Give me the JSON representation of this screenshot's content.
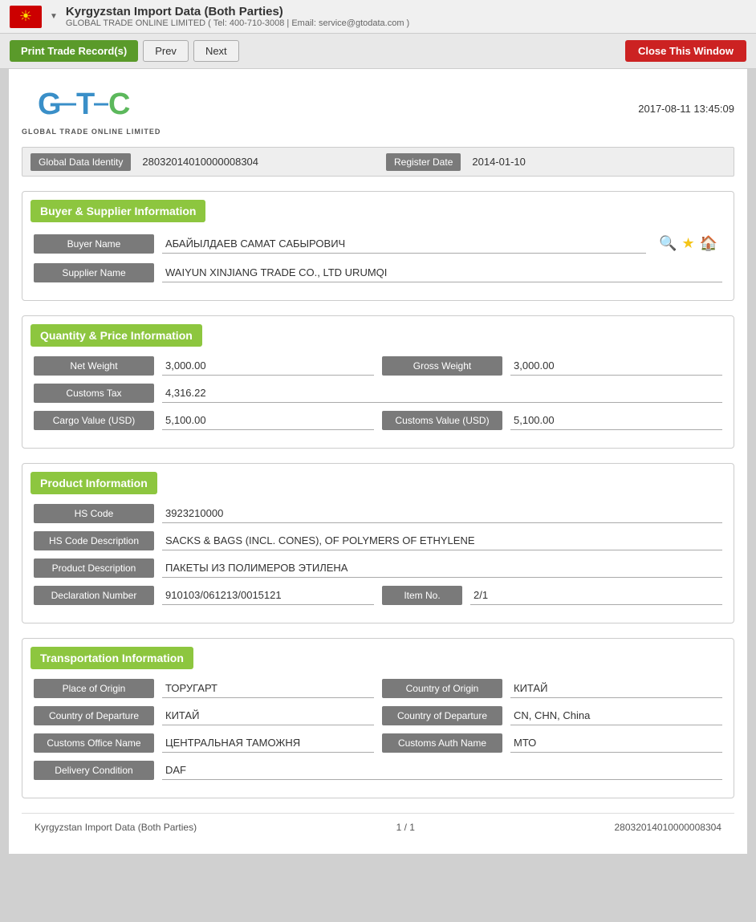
{
  "topbar": {
    "flag_emoji": "🏳",
    "title": "Kyrgyzstan Import Data (Both Parties)",
    "subtitle": "GLOBAL TRADE ONLINE LIMITED ( Tel: 400-710-3008 | Email: service@gtodata.com )",
    "dropdown_label": "▼"
  },
  "toolbar": {
    "print_label": "Print Trade Record(s)",
    "prev_label": "Prev",
    "next_label": "Next",
    "close_label": "Close This Window"
  },
  "record": {
    "timestamp": "2017-08-11 13:45:09",
    "global_data_identity_label": "Global Data Identity",
    "global_data_identity_value": "28032014010000008304",
    "register_date_label": "Register Date",
    "register_date_value": "2014-01-10",
    "sections": {
      "buyer_supplier": {
        "title": "Buyer & Supplier Information",
        "buyer_name_label": "Buyer Name",
        "buyer_name_value": "АБАЙЫЛДАЕВ САМАТ САБЫРОВИЧ",
        "supplier_name_label": "Supplier Name",
        "supplier_name_value": "WAIYUN XINJIANG TRADE CO., LTD URUMQI"
      },
      "quantity_price": {
        "title": "Quantity & Price Information",
        "net_weight_label": "Net Weight",
        "net_weight_value": "3,000.00",
        "gross_weight_label": "Gross Weight",
        "gross_weight_value": "3,000.00",
        "customs_tax_label": "Customs Tax",
        "customs_tax_value": "4,316.22",
        "cargo_value_label": "Cargo Value (USD)",
        "cargo_value_value": "5,100.00",
        "customs_value_label": "Customs Value (USD)",
        "customs_value_value": "5,100.00"
      },
      "product": {
        "title": "Product Information",
        "hs_code_label": "HS Code",
        "hs_code_value": "3923210000",
        "hs_code_desc_label": "HS Code Description",
        "hs_code_desc_value": "SACKS & BAGS (INCL. CONES), OF POLYMERS OF ETHYLENE",
        "product_desc_label": "Product Description",
        "product_desc_value": "ПАКЕТЫ ИЗ ПОЛИМЕРОВ ЭТИЛЕНА",
        "declaration_number_label": "Declaration Number",
        "declaration_number_value": "910103/061213/0015121",
        "item_no_label": "Item No.",
        "item_no_value": "2/1"
      },
      "transportation": {
        "title": "Transportation Information",
        "place_of_origin_label": "Place of Origin",
        "place_of_origin_value": "ТОРУГАРТ",
        "country_of_origin_label": "Country of Origin",
        "country_of_origin_value": "КИТАЙ",
        "country_of_departure_label": "Country of Departure",
        "country_of_departure_value": "КИТАЙ",
        "country_of_departure2_label": "Country of Departure",
        "country_of_departure2_value": "CN, CHN, China",
        "customs_office_label": "Customs Office Name",
        "customs_office_value": "ЦЕНТРАЛЬНАЯ ТАМОЖНЯ",
        "customs_auth_label": "Customs Auth Name",
        "customs_auth_value": "МТО",
        "delivery_condition_label": "Delivery Condition",
        "delivery_condition_value": "DAF"
      }
    }
  },
  "footer": {
    "left": "Kyrgyzstan Import Data (Both Parties)",
    "center": "1 / 1",
    "right": "28032014010000008304"
  }
}
